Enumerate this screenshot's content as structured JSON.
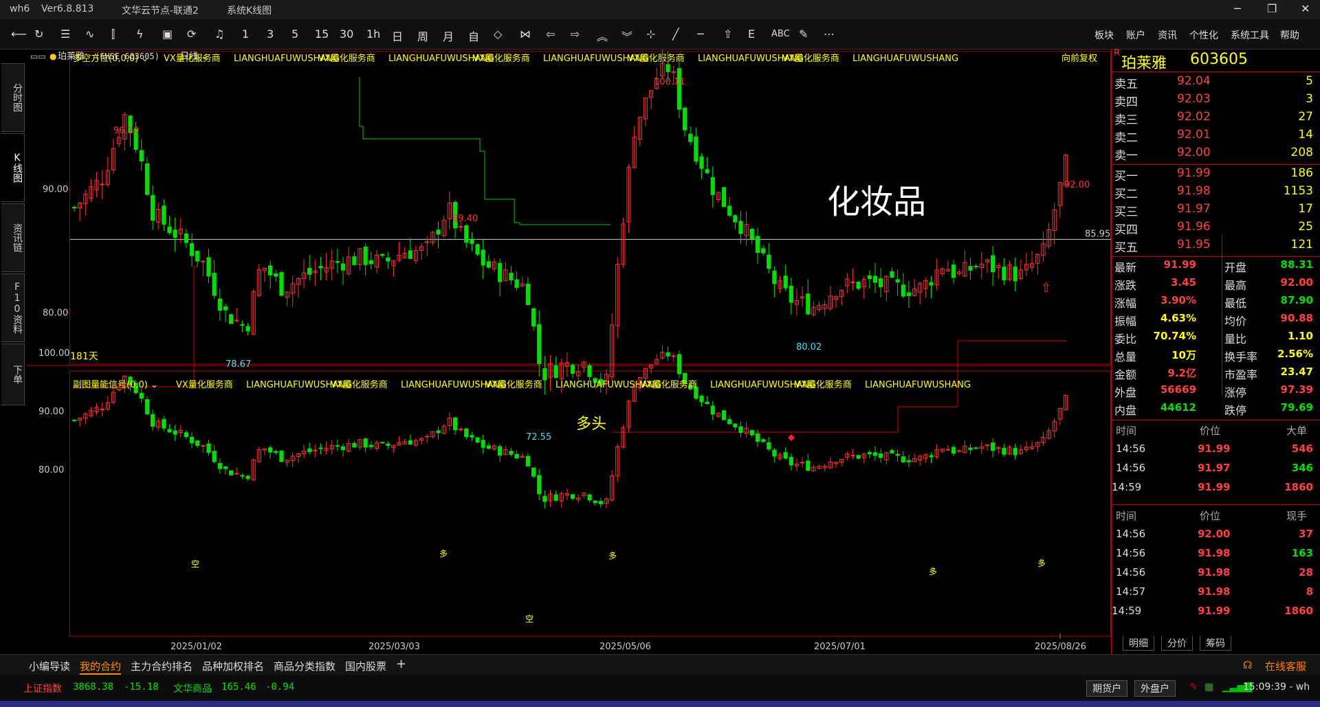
{
  "window": {
    "app": "wh6",
    "version": "Ver6.8.813",
    "server": "文华云节点-联通2",
    "title": "系统K线图"
  },
  "window_controls": {
    "minimize": "─",
    "maximize": "❐",
    "close": "✕"
  },
  "toolbar": {
    "periods": [
      "1",
      "3",
      "5",
      "15",
      "30",
      "1h",
      "日",
      "周",
      "月",
      "自"
    ],
    "text_tools": [
      "ABC"
    ],
    "menu": [
      "板块",
      "账户",
      "资讯",
      "个性化",
      "系统工具",
      "帮助"
    ]
  },
  "side_tabs": [
    "分时图",
    "K线图",
    "资讯链",
    "F10资料",
    "下单"
  ],
  "chart_header": {
    "name": "珀莱雅",
    "code": "(SHSE 603605)",
    "period": "日线"
  },
  "main_panel": {
    "indicator": "多空方位(0,0,0)",
    "ads": [
      "VX量化服务商",
      "LIANGHUAFUWUSHANG",
      "VX量化服务商",
      "LIANGHUAFUWUSHANG",
      "VX量化服务商",
      "LIANGHUAFUWUSHANG",
      "VX量化服务商",
      "LIANGHUAFUWUSHANG",
      "VX量化服务商",
      "LIANGHUAFUWUSHANG"
    ],
    "adjust": "向前复权",
    "days": "181天",
    "overlay_text": "化妆品",
    "signal_text": "多头",
    "hline_label": "85.95"
  },
  "sub_panel": {
    "indicator": "副图量能信号(0,0)",
    "ads": [
      "VX量化服务商",
      "LIANGHUAFUWUSHANG",
      "VX量化服务商",
      "LIANGHUAFUWUSHANG",
      "VX量化服务商",
      "LIANGHUAFUWUSHANG",
      "VX量化服务商",
      "LIANGHUAFUWUSHANG",
      "VX量化服务商",
      "LIANGHUAFUWUSHANG"
    ],
    "signals": [
      "空",
      "多",
      "多",
      "空",
      "多",
      "多"
    ]
  },
  "chart_data": {
    "type": "candlestick",
    "main_yticks": [
      "90.00",
      "80.00"
    ],
    "sub_yticks": [
      "100.00",
      "90.00",
      "80.00"
    ],
    "x_dates": [
      "2025/01/02",
      "2025/03/03",
      "2025/05/06",
      "2025/07/01",
      "2025/08/26"
    ],
    "annotations": [
      "96.20",
      "89.40",
      "100.11",
      "92.00",
      "78.67",
      "72.55",
      "80.02"
    ],
    "high": 100.11,
    "low": 72.55,
    "last": 92.0,
    "hline": 85.95
  },
  "quote": {
    "name": "珀莱雅",
    "code": "603605",
    "flag": "R",
    "asks": [
      {
        "label": "卖五",
        "price": "92.04",
        "vol": "5"
      },
      {
        "label": "卖四",
        "price": "92.03",
        "vol": "3"
      },
      {
        "label": "卖三",
        "price": "92.02",
        "vol": "27"
      },
      {
        "label": "卖二",
        "price": "92.01",
        "vol": "14"
      },
      {
        "label": "卖一",
        "price": "92.00",
        "vol": "208"
      }
    ],
    "bids": [
      {
        "label": "买一",
        "price": "91.99",
        "vol": "186"
      },
      {
        "label": "买二",
        "price": "91.98",
        "vol": "1153"
      },
      {
        "label": "买三",
        "price": "91.97",
        "vol": "17"
      },
      {
        "label": "买四",
        "price": "91.96",
        "vol": "25"
      },
      {
        "label": "买五",
        "price": "91.95",
        "vol": "121"
      }
    ],
    "stats": [
      [
        "最新",
        "91.99",
        "开盘",
        "88.31"
      ],
      [
        "涨跌",
        "3.45",
        "最高",
        "92.00"
      ],
      [
        "涨幅",
        "3.90%",
        "最低",
        "87.90"
      ],
      [
        "振幅",
        "4.63%",
        "均价",
        "90.88"
      ],
      [
        "委比",
        "70.74%",
        "量比",
        "1.10"
      ],
      [
        "总量",
        "10万",
        "换手率",
        "2.56%"
      ],
      [
        "金额",
        "9.2亿",
        "市盈率",
        "23.47"
      ],
      [
        "外盘",
        "56669",
        "涨停",
        "97.39"
      ],
      [
        "内盘",
        "44612",
        "跌停",
        "79.69"
      ]
    ],
    "ticks1_header": [
      "时间",
      "价位",
      "大单"
    ],
    "ticks1": [
      [
        "14:56",
        "91.99",
        "546"
      ],
      [
        "14:56",
        "91.97",
        "346"
      ],
      [
        "14:59",
        "91.99",
        "1860"
      ]
    ],
    "ticks2_header": [
      "时间",
      "价位",
      "现手"
    ],
    "ticks2": [
      [
        "14:56",
        "92.00",
        "37"
      ],
      [
        "14:56",
        "91.98",
        "163"
      ],
      [
        "14:56",
        "91.98",
        "28"
      ],
      [
        "14:57",
        "91.98",
        "8"
      ],
      [
        "14:59",
        "91.99",
        "1860"
      ]
    ],
    "tabs": [
      "明细",
      "分价",
      "筹码"
    ]
  },
  "bottom_tabs": [
    "小编导读",
    "我的合约",
    "主力合约排名",
    "品种加权排名",
    "商品分类指数",
    "国内股票"
  ],
  "service": "在线客服",
  "status": {
    "index1_name": "上证指数",
    "index1_val": "3868.38",
    "index1_chg": "-15.18",
    "index2_name": "文华商品",
    "index2_val": "165.46",
    "index2_chg": "-0.94",
    "btn1": "期货户",
    "btn2": "外盘户",
    "time": "15:09:39 - wh"
  },
  "colors": {
    "up": "#ff3030",
    "down": "#00e000",
    "label": "#ffff00",
    "cyan": "#40e0f0",
    "border": "#c00000"
  }
}
